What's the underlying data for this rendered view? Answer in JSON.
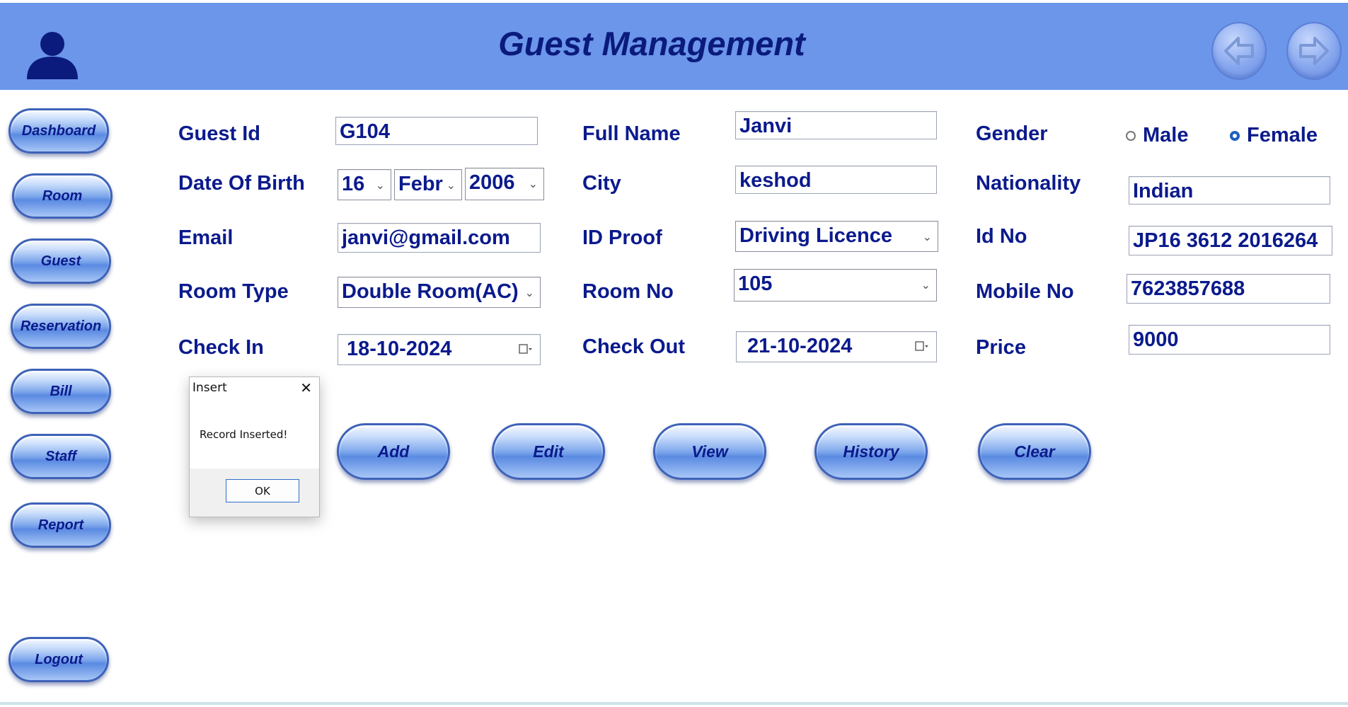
{
  "header": {
    "title": "Guest Management",
    "user_icon": "user-icon",
    "back_icon": "arrow-left-icon",
    "forward_icon": "arrow-right-icon",
    "bg_color": "#6b96ea"
  },
  "sidebar": {
    "items": [
      {
        "label": "Dashboard"
      },
      {
        "label": "Room"
      },
      {
        "label": "Guest"
      },
      {
        "label": "Reservation"
      },
      {
        "label": "Bill"
      },
      {
        "label": "Staff"
      },
      {
        "label": "Report"
      }
    ],
    "logout": "Logout"
  },
  "form": {
    "guest_id": {
      "label": "Guest Id",
      "value": "G104"
    },
    "full_name": {
      "label": "Full Name",
      "value": "Janvi"
    },
    "gender": {
      "label": "Gender",
      "options": [
        "Male",
        "Female"
      ],
      "selected": "Female"
    },
    "dob": {
      "label": "Date Of Birth",
      "day": "16",
      "month": "Febr",
      "year": "2006"
    },
    "city": {
      "label": "City",
      "value": "keshod"
    },
    "nationality": {
      "label": "Nationality",
      "value": "Indian"
    },
    "email": {
      "label": "Email",
      "value": "janvi@gmail.com"
    },
    "id_proof": {
      "label": "ID Proof",
      "value": "Driving Licence"
    },
    "id_no": {
      "label": "Id No",
      "value": "JP16 3612 2016264"
    },
    "room_type": {
      "label": "Room Type",
      "value": "Double Room(AC)"
    },
    "room_no": {
      "label": "Room No",
      "value": "105"
    },
    "mobile_no": {
      "label": "Mobile No",
      "value": "7623857688"
    },
    "check_in": {
      "label": "Check In",
      "value": "18-10-2024"
    },
    "check_out": {
      "label": "Check Out",
      "value": "21-10-2024"
    },
    "price": {
      "label": "Price",
      "value": "9000"
    }
  },
  "actions": {
    "add": "Add",
    "edit": "Edit",
    "view": "View",
    "history": "History",
    "clear": "Clear"
  },
  "dialog": {
    "title": "Insert",
    "message": "Record Inserted!",
    "ok": "OK"
  }
}
